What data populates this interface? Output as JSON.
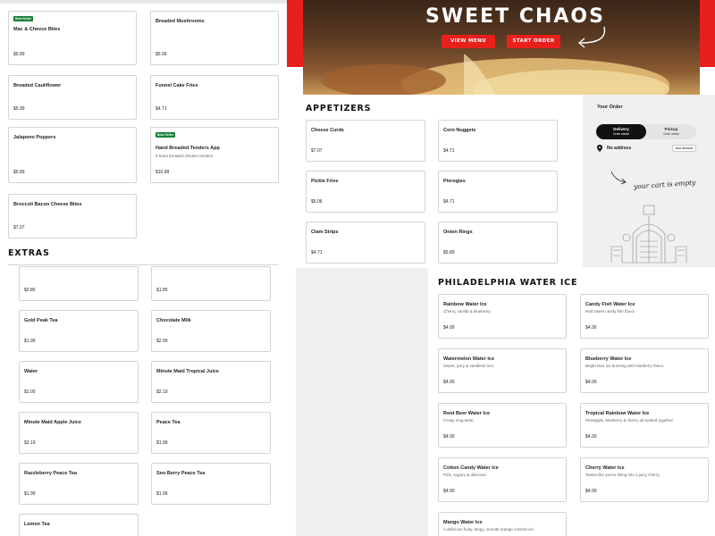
{
  "hero": {
    "title": "SWEET CHAOS",
    "view_menu": "VIEW MENU",
    "start_order": "START ORDER"
  },
  "left_cards": [
    {
      "badge": "Best Seller",
      "name": "Mac & Cheese Bites",
      "price": "$5.89"
    },
    {
      "name": "Breaded Mushrooms",
      "price": "$5.06"
    },
    {
      "name": "Breaded Cauliflower",
      "price": "$5.99"
    },
    {
      "name": "Funnel Cake Fries",
      "price": "$4.71"
    },
    {
      "name": "Jalapeno Poppers",
      "price": "$5.89"
    },
    {
      "badge": "Best Seller",
      "name": "Hand Breaded Tenders App",
      "desc": "5 hand breaded chicken tenders",
      "price": "$10.99"
    },
    {
      "name": "Broccoli Bacon Cheese Bites",
      "price": "$7.07"
    }
  ],
  "appetizers": {
    "title": "APPETIZERS",
    "items": [
      {
        "name": "Cheese Curds",
        "price": "$7.07"
      },
      {
        "name": "Corn Nuggets",
        "price": "$4.71"
      },
      {
        "name": "Pickle Fries",
        "price": "$5.06"
      },
      {
        "name": "Pierogies",
        "price": "$4.71"
      },
      {
        "name": "Clam Strips",
        "price": "$4.71"
      },
      {
        "name": "Onion Rings",
        "price": "$5.89"
      }
    ]
  },
  "order": {
    "title": "Your Order",
    "delivery": "Delivery",
    "delivery_sub": "Order ahead",
    "pickup": "Pickup",
    "pickup_sub": "Order ahead",
    "no_address": "No address",
    "add_address": "Add address",
    "empty_cart": "your cart is empty"
  },
  "extras": {
    "title": "EXTRAS",
    "items": [
      {
        "name": "",
        "price": "$0.85"
      },
      {
        "name": "",
        "price": "$1.85"
      },
      {
        "name": "Gold Peak Tea",
        "price": "$1.99"
      },
      {
        "name": "Chocolate Milk",
        "price": "$2.99"
      },
      {
        "name": "Water",
        "price": "$1.00"
      },
      {
        "name": "Minute Maid Tropical Juice",
        "price": "$2.19"
      },
      {
        "name": "Minute Maid Apple Juice",
        "price": "$2.19"
      },
      {
        "name": "Peace Tea",
        "price": "$1.99"
      },
      {
        "name": "Razzleberry Peace Tea",
        "price": "$1.99"
      },
      {
        "name": "Sno Berry Peace Tea",
        "price": "$1.99"
      },
      {
        "name": "Lemon Tea",
        "price": ""
      }
    ]
  },
  "water_ice": {
    "title": "PHILADELPHIA WATER ICE",
    "items": [
      {
        "name": "Rainbow Water Ice",
        "desc": "Cherry, vanilla & blueberry.",
        "price": "$4.00"
      },
      {
        "name": "Candy Fish Water Ice",
        "desc": "Red sweet candy fish flavor.",
        "price": "$4.00"
      },
      {
        "name": "Watermelon Water Ice",
        "desc": "Sweet, juicy & seedless too!",
        "price": "$4.00"
      },
      {
        "name": "Blueberry Water Ice",
        "desc": "Bright blue ice bursting with blueberry flavor.",
        "price": "$4.00"
      },
      {
        "name": "Root Beer Water Ice",
        "desc": "Frosty mug taste.",
        "price": "$4.00"
      },
      {
        "name": "Tropical Rainbow Water Ice",
        "desc": "Pineapple, blueberry & cherry all swirled together.",
        "price": "$4.00"
      },
      {
        "name": "Cotton Candy Water Ice",
        "desc": "Pink, sugary & delicious.",
        "price": "$4.00"
      },
      {
        "name": "Cherry Water Ice",
        "desc": "Tastes like you're biting into a juicy cherry.",
        "price": "$4.00"
      },
      {
        "name": "Mango Water Ice",
        "desc": "A delicious fruity, tangy, smooth orange colored ice.",
        "price": ""
      }
    ]
  },
  "colors": {
    "brand_red": "#e8201c",
    "badge_green": "#1a7f37",
    "panel_gray": "#f0f0f0"
  }
}
